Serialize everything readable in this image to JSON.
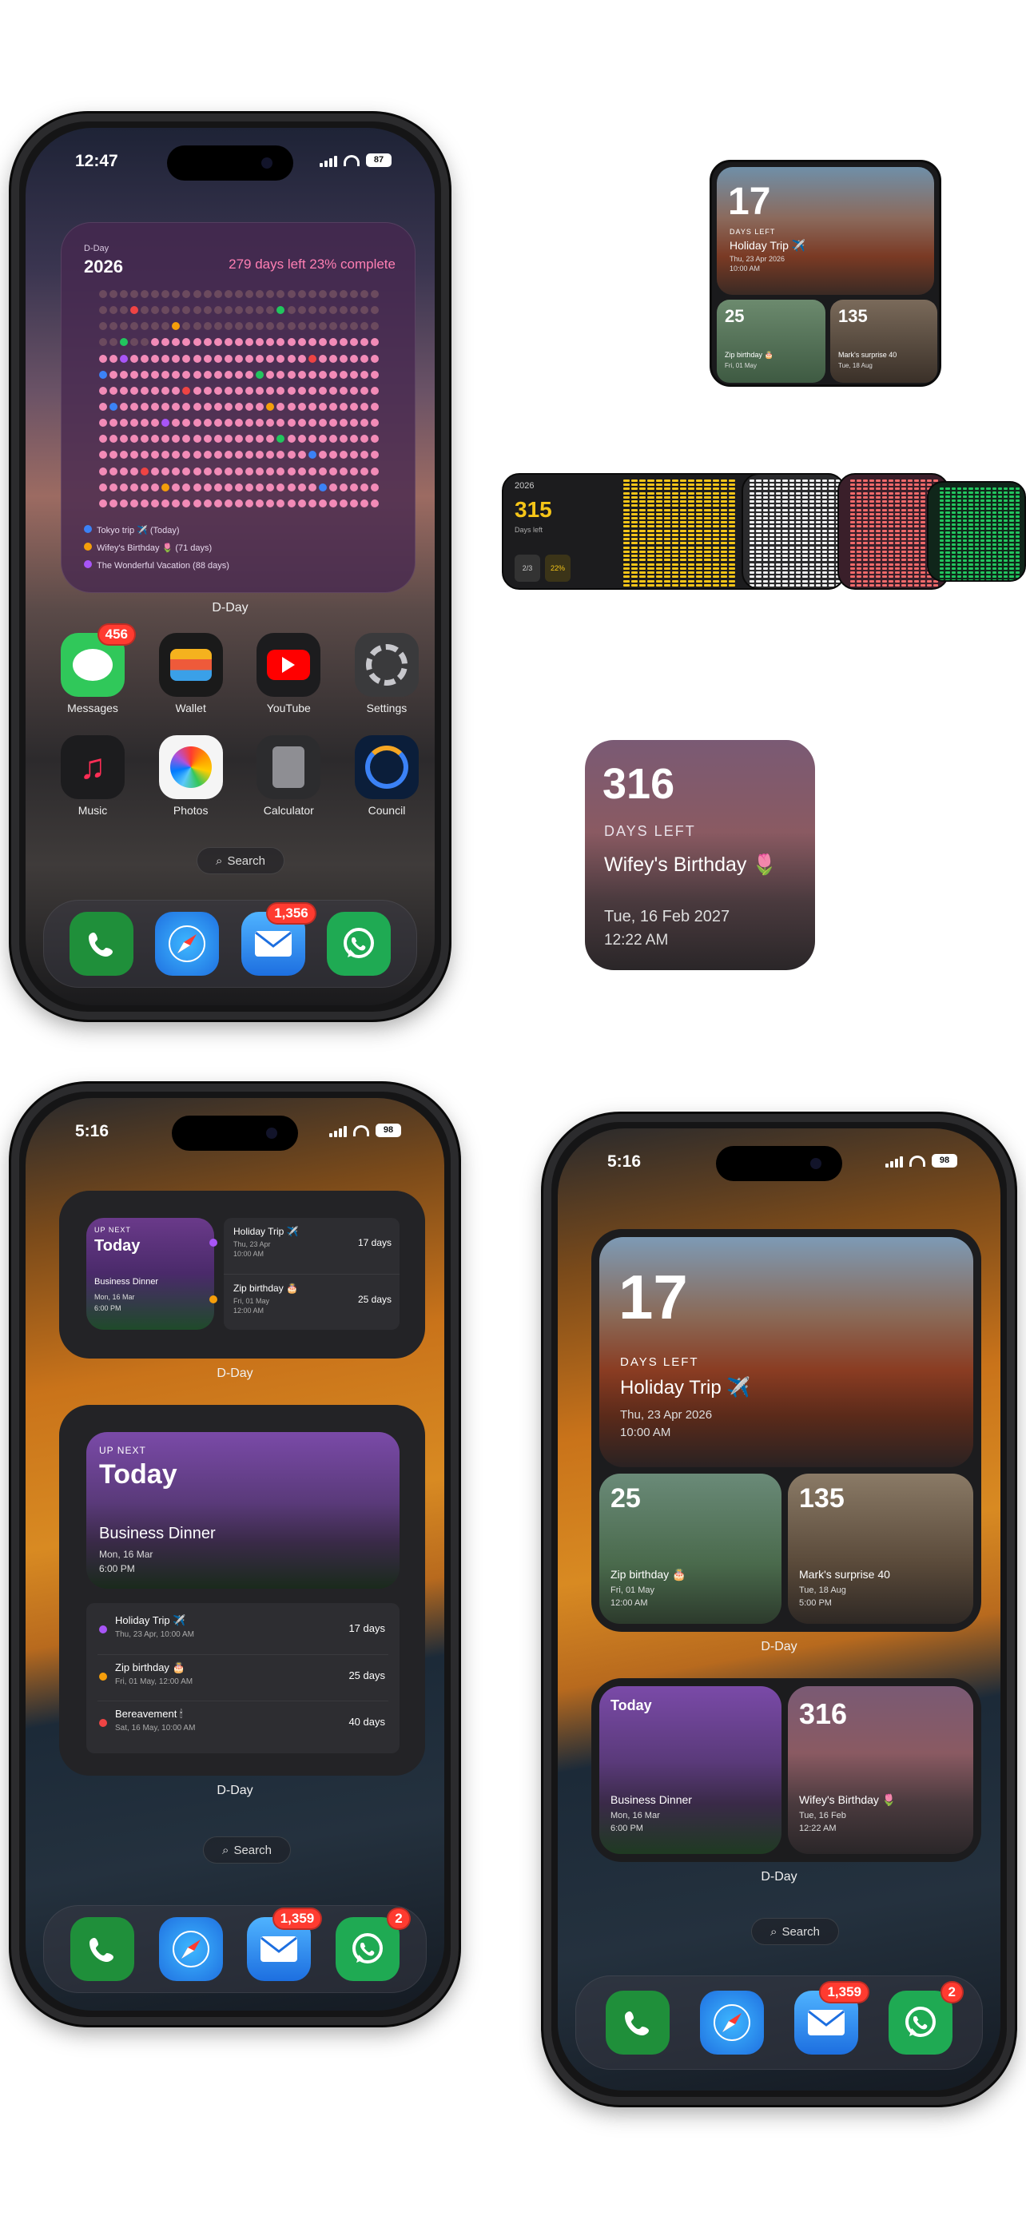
{
  "phone1": {
    "status": {
      "time": "12:47",
      "battery": "87"
    },
    "year_widget": {
      "subtitle": "D-Day",
      "year": "2026",
      "summary": "279 days left  23% complete",
      "events": [
        {
          "label": "Tokyo trip ✈️ (Today)",
          "color": "#3b82f6"
        },
        {
          "label": "Wifey's Birthday 🌷 (71 days)",
          "color": "#f59e0b"
        },
        {
          "label": "The Wonderful Vacation (88 days)",
          "color": "#a855f7"
        }
      ],
      "label": "D-Day"
    },
    "apps_row1": [
      {
        "name": "Messages",
        "badge": "456"
      },
      {
        "name": "Wallet",
        "badge": ""
      },
      {
        "name": "YouTube",
        "badge": ""
      },
      {
        "name": "Settings",
        "badge": ""
      }
    ],
    "apps_row2": [
      {
        "name": "Music"
      },
      {
        "name": "Photos"
      },
      {
        "name": "Calculator"
      },
      {
        "name": "Council"
      }
    ],
    "search": "Search",
    "dock_badges": {
      "mail": "1,356",
      "whatsapp": ""
    }
  },
  "preview_small": {
    "big": {
      "number": "17",
      "caption": "DAYS LEFT",
      "title": "Holiday Trip ✈️",
      "date": "Thu, 23 Apr 2026",
      "time": "10:00 AM"
    },
    "tiles": [
      {
        "number": "25",
        "title": "Zip birthday 🎂",
        "date": "Fri, 01 May"
      },
      {
        "number": "135",
        "title": "Mark's surprise 40",
        "date": "Tue, 18 Aug"
      }
    ]
  },
  "preview_strip": {
    "year": "2026",
    "number": "315",
    "caption": "Days left",
    "chips": [
      "2/3",
      "22%"
    ]
  },
  "preview_square": {
    "number": "316",
    "caption": "DAYS LEFT",
    "title": "Wifey's Birthday 🌷",
    "date": "Tue, 16 Feb 2027",
    "time": "12:22 AM"
  },
  "phone3": {
    "status": {
      "time": "5:16",
      "battery": "98"
    },
    "mini_widget": {
      "upnext": "UP NEXT",
      "today": "Today",
      "title": "Business Dinner",
      "date": "Mon, 16 Mar",
      "time": "6:00 PM",
      "items": [
        {
          "title": "Holiday Trip ✈️",
          "date": "Thu, 23 Apr",
          "time": "10:00 AM",
          "days": "17 days",
          "color": "#a855f7"
        },
        {
          "title": "Zip birthday 🎂",
          "date": "Fri, 01 May",
          "time": "12:00 AM",
          "days": "25 days",
          "color": "#f59e0b"
        }
      ],
      "label": "D-Day"
    },
    "big_widget": {
      "upnext": "UP NEXT",
      "today": "Today",
      "sub": "",
      "title": "Business Dinner",
      "date": "Mon, 16 Mar",
      "time": "6:00 PM",
      "items": [
        {
          "title": "Holiday Trip ✈️",
          "date": "Thu, 23 Apr, 10:00 AM",
          "days": "17 days",
          "color": "#a855f7"
        },
        {
          "title": "Zip birthday 🎂",
          "date": "Fri, 01 May, 12:00 AM",
          "days": "25 days",
          "color": "#f59e0b"
        },
        {
          "title": "Bereavement 🕯",
          "date": "Sat, 16 May, 10:00 AM",
          "days": "40 days",
          "color": "#ef4444"
        }
      ],
      "label": "D-Day"
    },
    "search": "Search",
    "dock_badges": {
      "mail": "1,359",
      "whatsapp": "2"
    }
  },
  "phone4": {
    "status": {
      "time": "5:16",
      "battery": "98"
    },
    "top_widget": {
      "number": "17",
      "caption": "DAYS LEFT",
      "title": "Holiday Trip ✈️",
      "date": "Thu, 23 Apr 2026",
      "time": "10:00 AM",
      "tiles": [
        {
          "number": "25",
          "title": "Zip birthday 🎂",
          "date": "Fri, 01 May",
          "time": "12:00 AM"
        },
        {
          "number": "135",
          "title": "Mark's surprise 40",
          "date": "Tue, 18 Aug",
          "time": "5:00 PM"
        }
      ],
      "label": "D-Day"
    },
    "bottom_widget": {
      "left": {
        "today": "Today",
        "title": "Business Dinner",
        "date": "Mon, 16 Mar",
        "time": "6:00 PM"
      },
      "right": {
        "number": "316",
        "title": "Wifey's Birthday 🌷",
        "date": "Tue, 16 Feb",
        "time": "12:22 AM"
      },
      "label": "D-Day"
    },
    "search": "Search",
    "dock_badges": {
      "mail": "1,359",
      "whatsapp": "2"
    }
  },
  "colors": {
    "accent_yellow": "#f5c518",
    "pink_dot": "#f28bb7",
    "used_dot": "#6b4a5e",
    "badge": "#ff3b30"
  }
}
